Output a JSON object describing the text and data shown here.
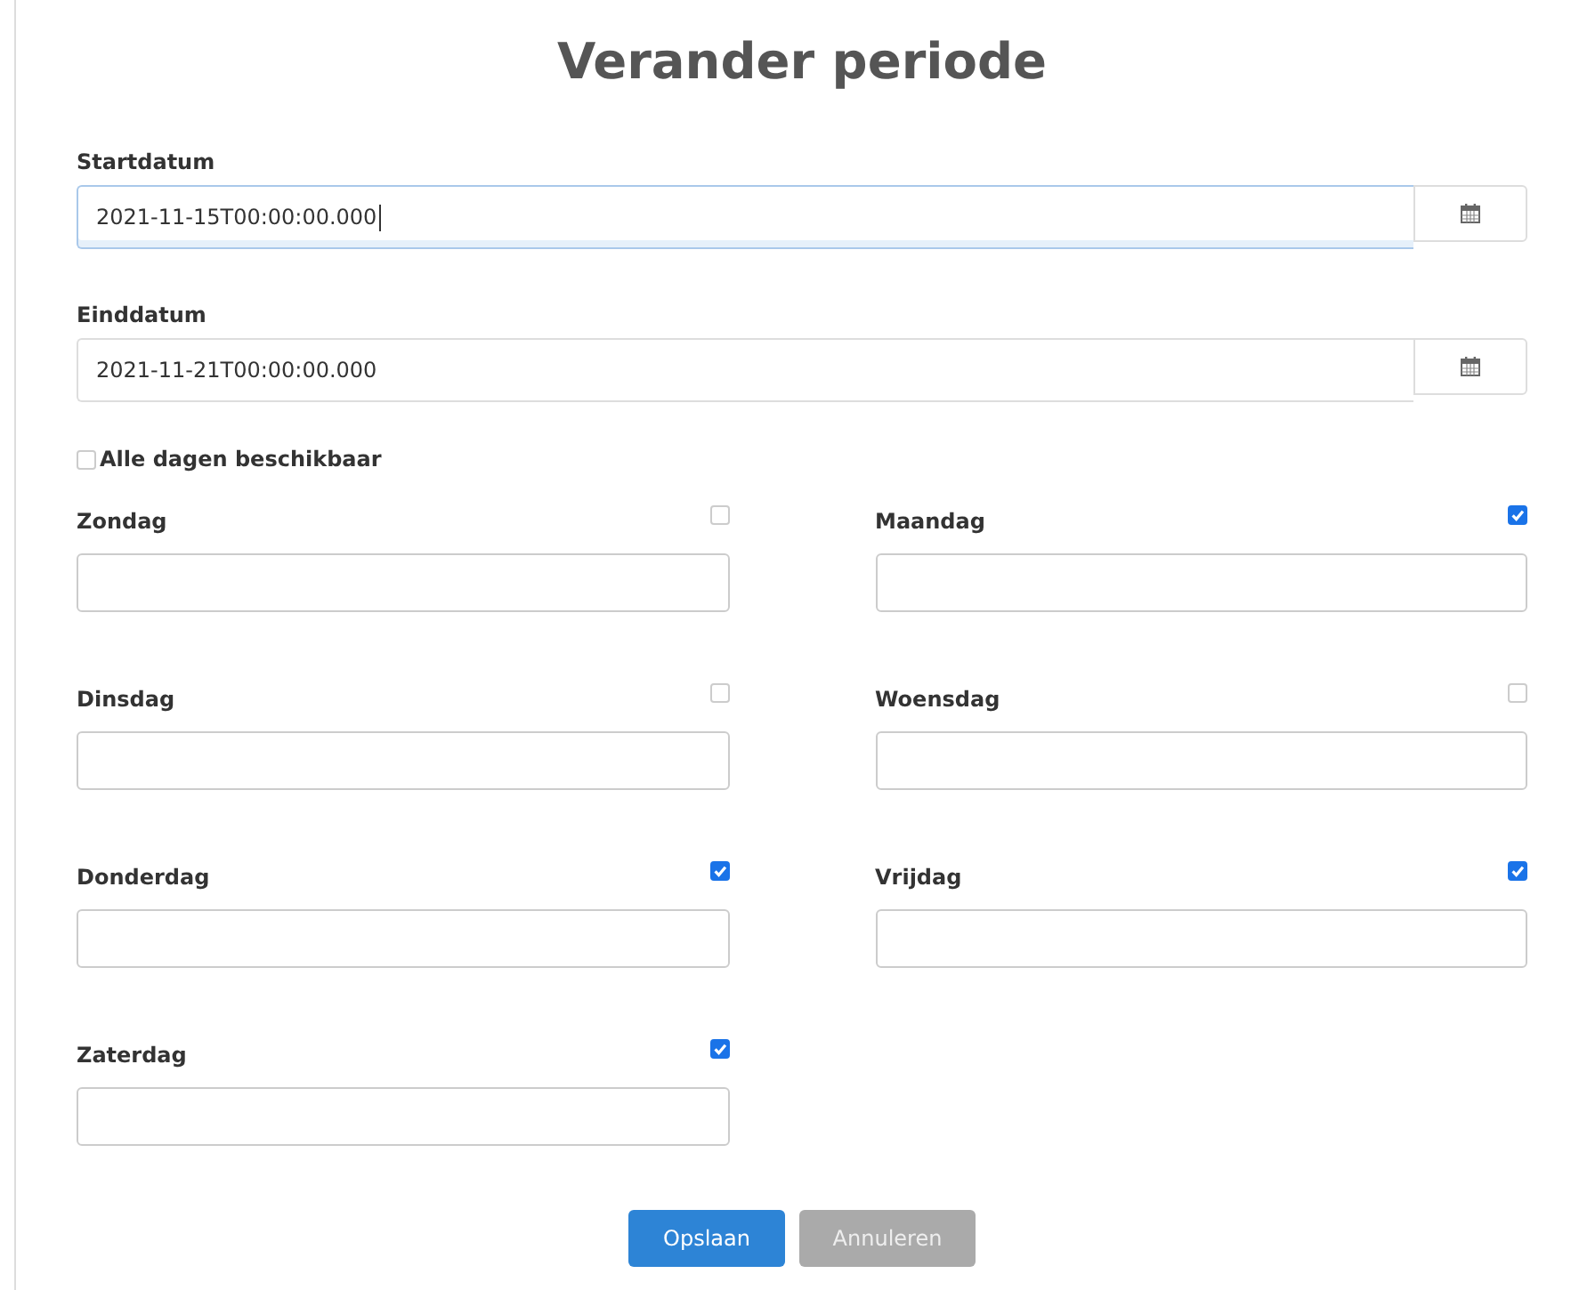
{
  "title": "Verander periode",
  "date_fields": [
    {
      "label": "Startdatum",
      "value": "2021-11-15T00:00:00.000",
      "focused": true
    },
    {
      "label": "Einddatum",
      "value": "2021-11-21T00:00:00.000",
      "focused": false
    }
  ],
  "all_days": {
    "label": "Alle dagen beschikbaar",
    "checked": false
  },
  "days": [
    {
      "label": "Zondag",
      "checked": false
    },
    {
      "label": "Maandag",
      "checked": true
    },
    {
      "label": "Dinsdag",
      "checked": false
    },
    {
      "label": "Woensdag",
      "checked": false
    },
    {
      "label": "Donderdag",
      "checked": true
    },
    {
      "label": "Vrijdag",
      "checked": true
    },
    {
      "label": "Zaterdag",
      "checked": true
    }
  ],
  "buttons": [
    {
      "label": "Opslaan",
      "kind": "primary"
    },
    {
      "label": "Annuleren",
      "kind": "secondary"
    }
  ]
}
